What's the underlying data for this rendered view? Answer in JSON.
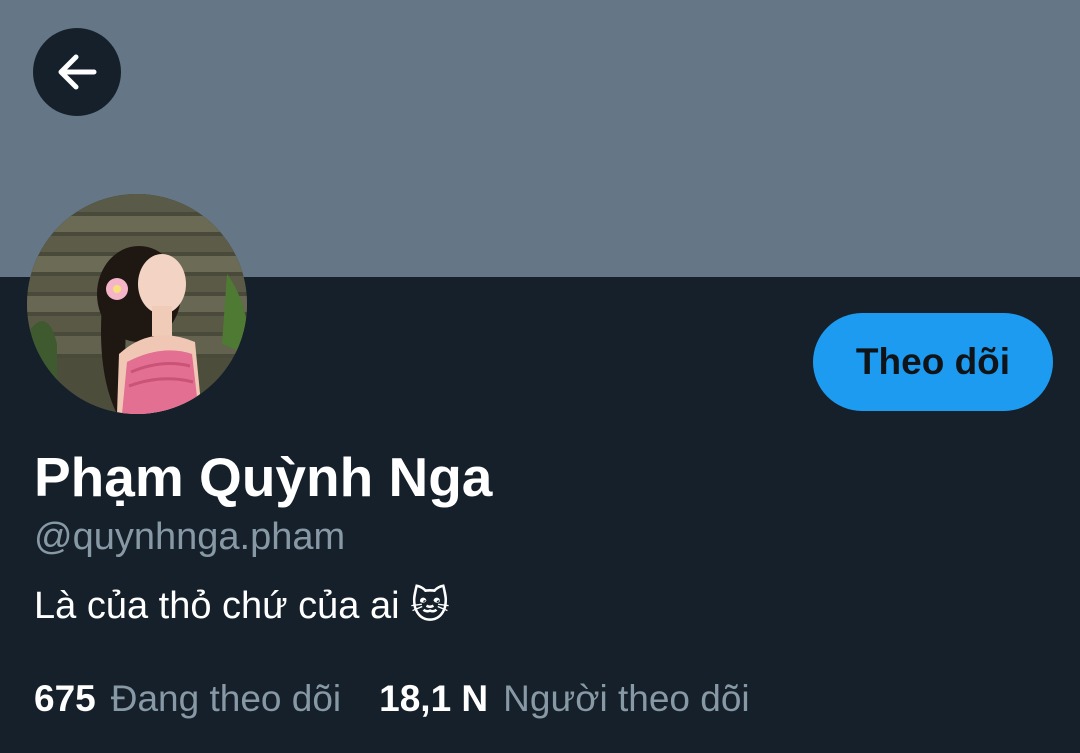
{
  "header": {
    "back_icon": "arrow-left-icon"
  },
  "profile": {
    "display_name": "Phạm Quỳnh Nga",
    "handle": "@quynhnga.pham",
    "bio": "Là của thỏ chứ của ai 🐱",
    "follow_label": "Theo dõi",
    "following_count": "675",
    "following_label": "Đang theo dõi",
    "followers_count": "18,1 N",
    "followers_label": "Người theo dõi"
  },
  "colors": {
    "background": "#15202b",
    "banner": "#657786",
    "accent": "#1d9bf0",
    "muted_text": "#8899a6"
  }
}
